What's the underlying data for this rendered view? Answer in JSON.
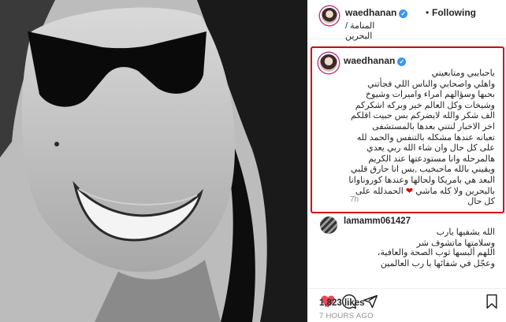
{
  "post": {
    "username": "waedhanan",
    "follow_status": "Following",
    "separator": "•",
    "location": "المنامة /البحرين",
    "caption": {
      "text": "ياحبايبي ومتابعيني\nواهلي واصحابي والناس اللي فجأتني\nبحبها وسؤالهم امراء واميرات وشيوخ\nوشيخات وكل العالم خير وبركه اشكركم\nالف شكر والله لايضركم بس حبيت اقلكم\nاخر الاخبار لنتني بعدها بالمستشفى\nتعبانه عندها مشكله بالتنفس والحمد لله\nعلى كل حال وان شاء الله ربي يعدي\nهالمرحله وانا مستودعتها عند الكريم\nويقيني بالله ماحبخيب ,بس انا حارق قلبي\nالبعد هي بامريكا ولحالها وعندها كوروناوانا\nبالبحرين ولا كله ماشي",
      "heart": "❤",
      "text_end": " الحمدلله على\nكل حال",
      "time": "7h"
    },
    "comments": [
      {
        "username": "lamamm061427",
        "text": "الله يشفيها يارب\nوسلامتها ماتشوف شر"
      },
      {
        "username": "",
        "text": "اللهم ألبسها ثوب الصحة والعافية،\nوعجّل في شفائها يا رب العالمين"
      }
    ],
    "likes": "1,823 likes",
    "posted": "7 HOURS AGO",
    "icons": [
      "heart-icon",
      "comment-icon",
      "share-icon",
      "bookmark-icon"
    ]
  },
  "colors": {
    "verified": "#3897f0",
    "highlight_border": "#d40000",
    "avatar_ring": "#c13584"
  }
}
